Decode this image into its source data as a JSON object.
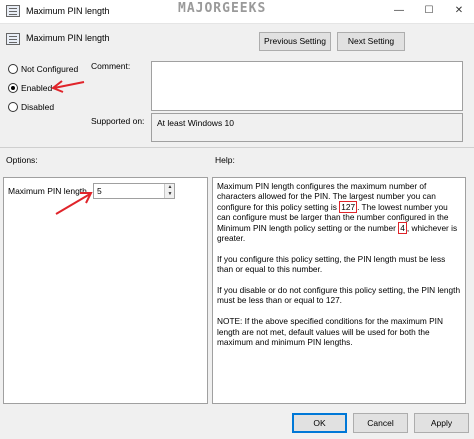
{
  "window": {
    "title": "Maximum PIN length",
    "watermark": "MAJORGEEKS",
    "minimize": "—",
    "maximize": "☐",
    "close": "✕"
  },
  "header": {
    "policy_name": "Maximum PIN length",
    "previous_setting": "Previous Setting",
    "next_setting": "Next Setting"
  },
  "state": {
    "not_configured": "Not Configured",
    "enabled": "Enabled",
    "disabled": "Disabled",
    "selected": "enabled"
  },
  "comment": {
    "label": "Comment:",
    "value": ""
  },
  "supported": {
    "label": "Supported on:",
    "value": "At least Windows 10"
  },
  "options": {
    "label": "Options:",
    "field_label": "Maximum PIN length",
    "field_value": "5"
  },
  "help": {
    "label": "Help:",
    "p1_a": "Maximum PIN length configures the maximum number of characters allowed for the PIN.  The largest number you can configure for this policy setting is ",
    "p1_max": "127",
    "p1_b": ". The lowest number you can configure must be larger than the number configured in the Minimum PIN length policy setting or the number ",
    "p1_min": "4",
    "p1_c": ", whichever is greater.",
    "p2": "If you configure this policy setting, the PIN length must be less than or equal to this number.",
    "p3": "If you disable or do not configure this policy setting, the PIN length must be less than or equal to 127.",
    "p4": "NOTE: If the above specified conditions for the maximum PIN length are not met, default values will be used for both the maximum and minimum PIN lengths."
  },
  "footer": {
    "ok": "OK",
    "cancel": "Cancel",
    "apply": "Apply"
  },
  "colors": {
    "annotation": "#e0242a",
    "default_button_border": "#0078d7"
  }
}
